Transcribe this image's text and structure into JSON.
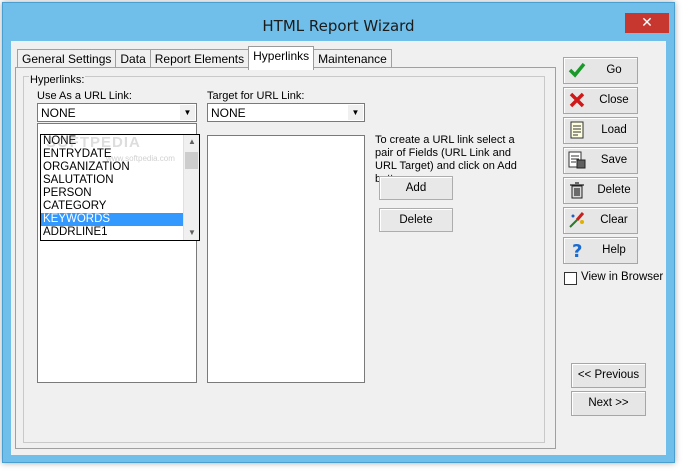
{
  "window": {
    "title": "HTML Report Wizard",
    "close_glyph": "✕"
  },
  "tabs": [
    {
      "label": "General Settings"
    },
    {
      "label": "Data"
    },
    {
      "label": "Report Elements"
    },
    {
      "label": "Hyperlinks"
    },
    {
      "label": "Maintenance"
    }
  ],
  "active_tab": "Hyperlinks",
  "hyperlinks": {
    "group_label": "Hyperlinks:",
    "url_link": {
      "label": "Use As a URL Link:",
      "value": "NONE",
      "options": [
        "NONE",
        "ENTRYDATE",
        "ORGANIZATION",
        "SALUTATION",
        "PERSON",
        "CATEGORY",
        "KEYWORDS",
        "ADDRLINE1"
      ],
      "highlighted": "KEYWORDS"
    },
    "target": {
      "label": "Target for URL Link:",
      "value": "NONE"
    },
    "info_text": "To create a URL link select a pair of Fields (URL Link and URL Target) and click on Add button.",
    "add_label": "Add",
    "delete_label": "Delete"
  },
  "commands": {
    "go": {
      "label": "Go",
      "icon": "checkmark-icon"
    },
    "close": {
      "label": "Close",
      "icon": "red-x-icon"
    },
    "load": {
      "label": "Load",
      "icon": "document-icon"
    },
    "save": {
      "label": "Save",
      "icon": "save-document-icon"
    },
    "delete": {
      "label": "Delete",
      "icon": "trash-can-icon"
    },
    "clear": {
      "label": "Clear",
      "icon": "eraser-icon"
    },
    "help": {
      "label": "Help",
      "icon": "question-mark-icon"
    }
  },
  "view_in_browser": {
    "label": "View in Browser",
    "checked": false
  },
  "nav": {
    "previous": "<< Previous",
    "next": "Next >>"
  },
  "watermark": {
    "text": "SOFTPEDIA",
    "subtext": "www.softpedia.com"
  },
  "colors": {
    "selection": "#3399ff",
    "titlebar": "#6fbfea",
    "close_button": "#c7372f"
  }
}
